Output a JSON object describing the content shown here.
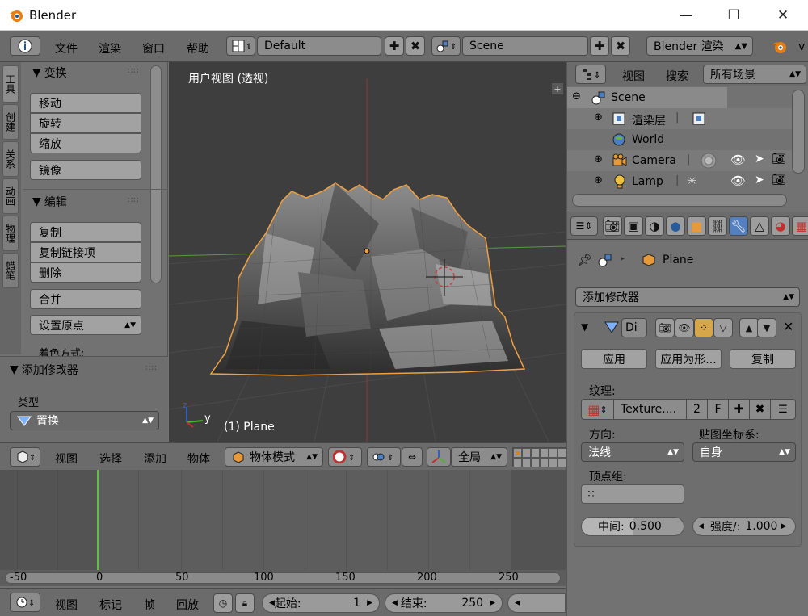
{
  "window": {
    "title": "Blender",
    "minimize": "—",
    "maximize": "☐",
    "close": "✕"
  },
  "info_header": {
    "menus": [
      "文件",
      "渲染",
      "窗口",
      "帮助"
    ],
    "layout": "Default",
    "scene": "Scene",
    "engine": "Blender 渲染",
    "version_hint": "v"
  },
  "toolshelf": {
    "tabs": [
      "工具",
      "创建",
      "关系",
      "动画",
      "物理",
      "蜡笔"
    ],
    "transform_title": "变换",
    "transform_buttons": [
      "移动",
      "旋转",
      "缩放"
    ],
    "mirror": "镜像",
    "edit_title": "编辑",
    "edit_buttons": [
      "复制",
      "复制链接项",
      "删除"
    ],
    "join": "合并",
    "set_origin": "设置原点",
    "shading": "着色方式:",
    "operator_title": "添加修改器",
    "type_label": "类型",
    "type_value": "置换"
  },
  "viewport": {
    "label": "用户视图 (透视)",
    "object_label": "(1) Plane",
    "axis_y": "y",
    "axis_z": "z"
  },
  "timeline_header": {
    "menus": [
      "视图",
      "选择",
      "添加",
      "物体"
    ],
    "mode": "物体模式",
    "orientation": "全局"
  },
  "timeline": {
    "ticks": [
      "-50",
      "0",
      "50",
      "100",
      "150",
      "200",
      "250"
    ],
    "footer_menus": [
      "视图",
      "标记",
      "帧",
      "回放"
    ],
    "start_label": "起始:",
    "start_value": "1",
    "end_label": "结束:",
    "end_value": "250"
  },
  "outliner": {
    "menus": [
      "视图",
      "搜索"
    ],
    "filter": "所有场景",
    "items": [
      {
        "name": "Scene"
      },
      {
        "name": "渲染层"
      },
      {
        "name": "World"
      },
      {
        "name": "Camera"
      },
      {
        "name": "Lamp"
      }
    ]
  },
  "properties": {
    "object_name": "Plane",
    "add_modifier": "添加修改器",
    "modifier_name": "Di",
    "apply": "应用",
    "apply_as": "应用为形...",
    "copy": "复制",
    "texture_label": "纹理:",
    "texture_name": "Texture....",
    "texture_users": "2",
    "texture_fake": "F",
    "direction_label": "方向:",
    "direction_value": "法线",
    "coords_label": "贴图坐标系:",
    "coords_value": "自身",
    "vgroup_label": "顶点组:",
    "midlevel_label": "中间:",
    "midlevel_value": "0.500",
    "strength_label": "强度/:",
    "strength_value": "1.000"
  },
  "colors": {
    "accent": "#e87d0d",
    "selected_outline": "#f0a040",
    "x_axis": "#a03030",
    "y_axis": "#50a030"
  }
}
